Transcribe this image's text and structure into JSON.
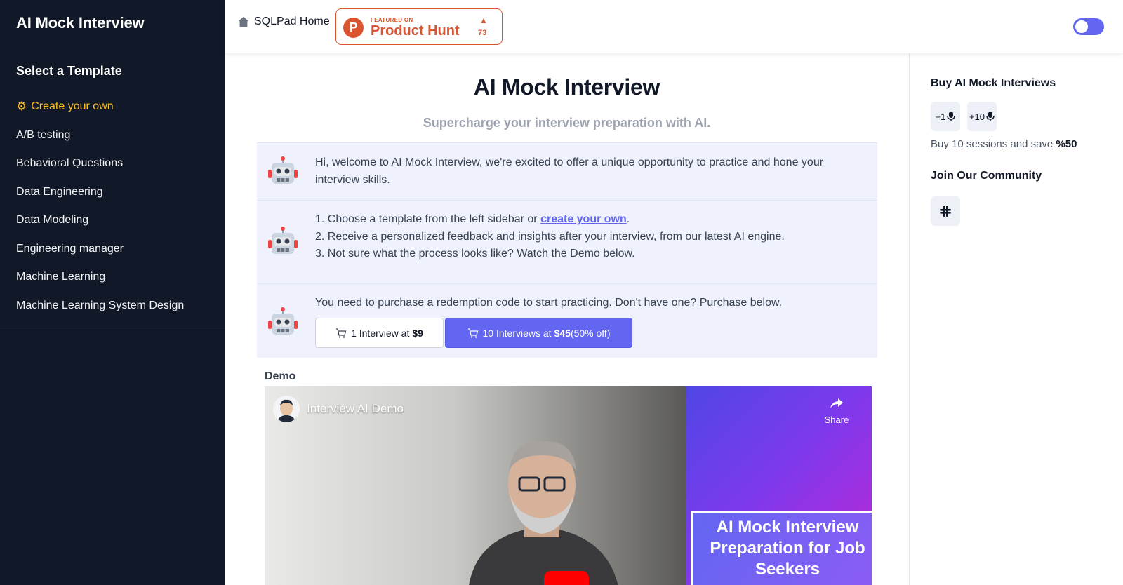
{
  "sidebar": {
    "title": "AI Mock Interview",
    "heading": "Select a Template",
    "items": [
      {
        "label": "Create your own",
        "icon": "gear-icon"
      },
      {
        "label": "A/B testing"
      },
      {
        "label": "Behavioral Questions"
      },
      {
        "label": "Data Engineering"
      },
      {
        "label": "Data Modeling"
      },
      {
        "label": "Engineering manager"
      },
      {
        "label": "Machine Learning"
      },
      {
        "label": "Machine Learning System Design"
      }
    ]
  },
  "topbar": {
    "home_label": "SQLPad Home",
    "product_hunt": {
      "featured": "FEATURED ON",
      "name": "Product Hunt",
      "logo_letter": "P",
      "count": "73"
    }
  },
  "main": {
    "title": "AI Mock Interview",
    "subtitle": "Supercharge your interview preparation with AI.",
    "message1": "Hi, welcome to AI Mock Interview, we're excited to offer a unique opportunity to practice and hone your interview skills.",
    "message2": {
      "line1_prefix": "1. Choose a template from the left sidebar or ",
      "line1_link": "create your own",
      "line1_suffix": ".",
      "line2": "2. Receive a personalized feedback and insights after your interview, from our latest AI engine.",
      "line3": "3. Not sure what the process looks like? Watch the Demo below."
    },
    "message3": {
      "text": "You need to purchase a redemption code to start practicing. Don't have one? Purchase below.",
      "btn1_prefix": "1 Interview at",
      "btn1_price": "$9",
      "btn2_prefix": "10 Interviews at",
      "btn2_price": "$45",
      "btn2_suffix": "(50% off)"
    },
    "demo_label": "Demo",
    "video": {
      "title": "Interview AI Demo",
      "share_label": "Share",
      "card_line1": "AI Mock Interview",
      "card_line2": "Preparation for Job",
      "card_line3": "Seekers"
    }
  },
  "right_panel": {
    "buy_heading": "Buy AI Mock Interviews",
    "chip1": "+1",
    "chip2": "+10",
    "save_text": "Buy 10 sessions and save",
    "save_value": "%50",
    "community_heading": "Join Our Community"
  },
  "colors": {
    "sidebar_bg": "#111827",
    "accent": "#6366f1",
    "active_item": "#fbbf24",
    "product_hunt": "#da552f"
  }
}
